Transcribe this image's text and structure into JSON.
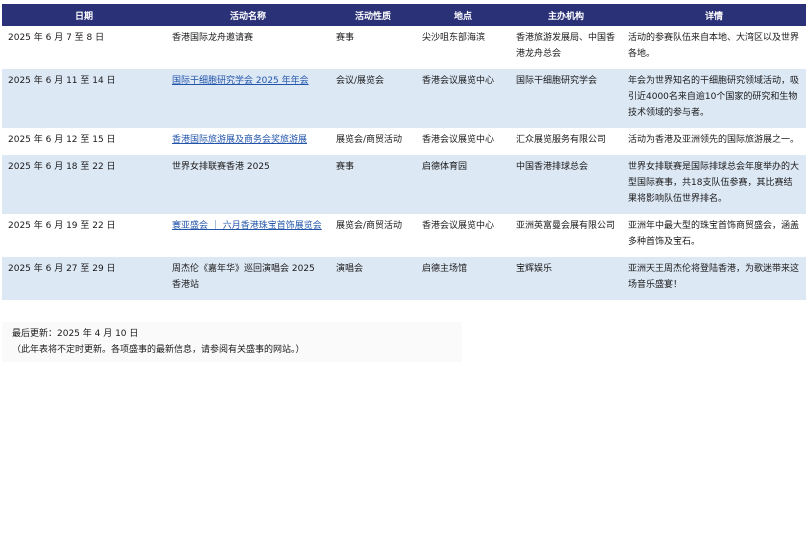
{
  "table": {
    "headers": {
      "date": "日期",
      "name": "活动名称",
      "type": "活动性质",
      "venue": "地点",
      "organizer": "主办机构",
      "details": "详情"
    },
    "rows": [
      {
        "date": "2025 年 6 月 7 至 8 日",
        "name": "香港国际龙舟邀请赛",
        "type": "赛事",
        "venue": "尖沙咀东部海滨",
        "organizer": "香港旅游发展局、中国香港龙舟总会",
        "details": "活动的参赛队伍来自本地、大湾区以及世界各地。"
      },
      {
        "date": "2025 年 6 月 11 至 14 日",
        "name": "国际干细胞研究学会 2025 年年会",
        "type": "会议/展览会",
        "venue": "香港会议展览中心",
        "organizer": "国际干细胞研究学会",
        "details": "年会为世界知名的干细胞研究领域活动，吸引近4000名来自逾10个国家的研究和生物技术领域的参与者。"
      },
      {
        "date": "2025 年 6 月 12 至 15 日",
        "name": "香港国际旅游展及商务会奖旅游展",
        "type": "展览会/商贸活动",
        "venue": "香港会议展览中心",
        "organizer": "汇众展览服务有限公司",
        "details": "活动为香港及亚洲领先的国际旅游展之一。"
      },
      {
        "date": "2025 年 6 月 18 至 22 日",
        "name": "世界女排联赛香港 2025",
        "type": "赛事",
        "venue": "启德体育园",
        "organizer": "中国香港排球总会",
        "details": "世界女排联赛是国际排球总会年度举办的大型国际赛事，共18支队伍参赛，其比赛结果将影响队伍世界排名。"
      },
      {
        "date": "2025 年 6 月 19 至 22 日",
        "name": "寰亚盛会 ｜ 六月香港珠宝首饰展览会",
        "type": "展览会/商贸活动",
        "venue": "香港会议展览中心",
        "organizer": "亚洲英富曼会展有限公司",
        "details": "亚洲年中最大型的珠宝首饰商贸盛会，涵盖多种首饰及宝石。"
      },
      {
        "date": "2025 年 6 月 27 至 29 日",
        "name": "周杰伦《嘉年华》巡回演唱会 2025 香港站",
        "type": "演唱会",
        "venue": "启德主场馆",
        "organizer": "宝辉娱乐",
        "details": "亚洲天王周杰伦将登陆香港，为歌迷带来这场音乐盛宴！"
      }
    ]
  },
  "footer": {
    "updated": "最后更新：2025 年 4 月 10 日",
    "note": "（此年表将不定时更新。各项盛事的最新信息，请参阅有关盛事的网站。）"
  }
}
